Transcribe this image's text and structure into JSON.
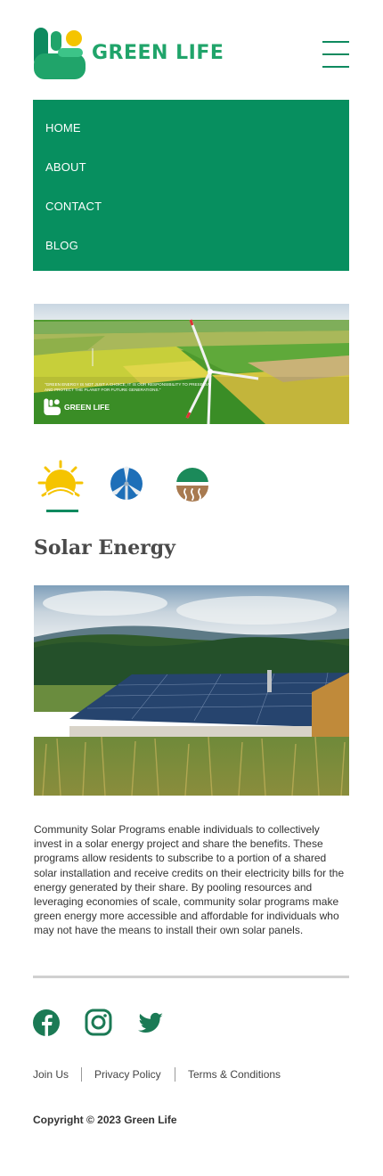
{
  "brand": {
    "name": "GREEN LIFE",
    "color": "#20a46a"
  },
  "nav": {
    "items": [
      {
        "label": "HOME"
      },
      {
        "label": "ABOUT"
      },
      {
        "label": "CONTACT"
      },
      {
        "label": "BLOG"
      }
    ],
    "background": "#078f5f"
  },
  "banner": {
    "quote": "\"Green energy is not just a choice, it is our responsibility to preserve and protect the planet for future generations.\"",
    "logo_text": "GREEN LIFE"
  },
  "energy_tabs": [
    {
      "icon": "sun-icon",
      "active": true
    },
    {
      "icon": "wind-turbine-icon",
      "active": false
    },
    {
      "icon": "geothermal-icon",
      "active": false
    }
  ],
  "section": {
    "title": "Solar Energy",
    "description": "Community Solar Programs enable individuals to collectively invest in a solar energy project and share the benefits. These programs allow residents to subscribe to a portion of a shared solar installation and receive credits on their electricity bills for the energy generated by their share. By pooling resources and leveraging economies of scale, community solar programs make green energy more accessible and affordable for individuals who may not have the means to install their own solar panels."
  },
  "socials": [
    {
      "icon": "facebook-icon"
    },
    {
      "icon": "instagram-icon"
    },
    {
      "icon": "twitter-icon"
    }
  ],
  "footer": {
    "links": [
      "Join Us",
      "Privacy Policy",
      "Terms & Conditions"
    ],
    "copyright": "Copyright © 2023 Green Life"
  },
  "colors": {
    "accent": "#0e8a5f",
    "sun": "#f5c400",
    "sky_blue": "#1e6fb8",
    "earth": "#a87a50"
  }
}
